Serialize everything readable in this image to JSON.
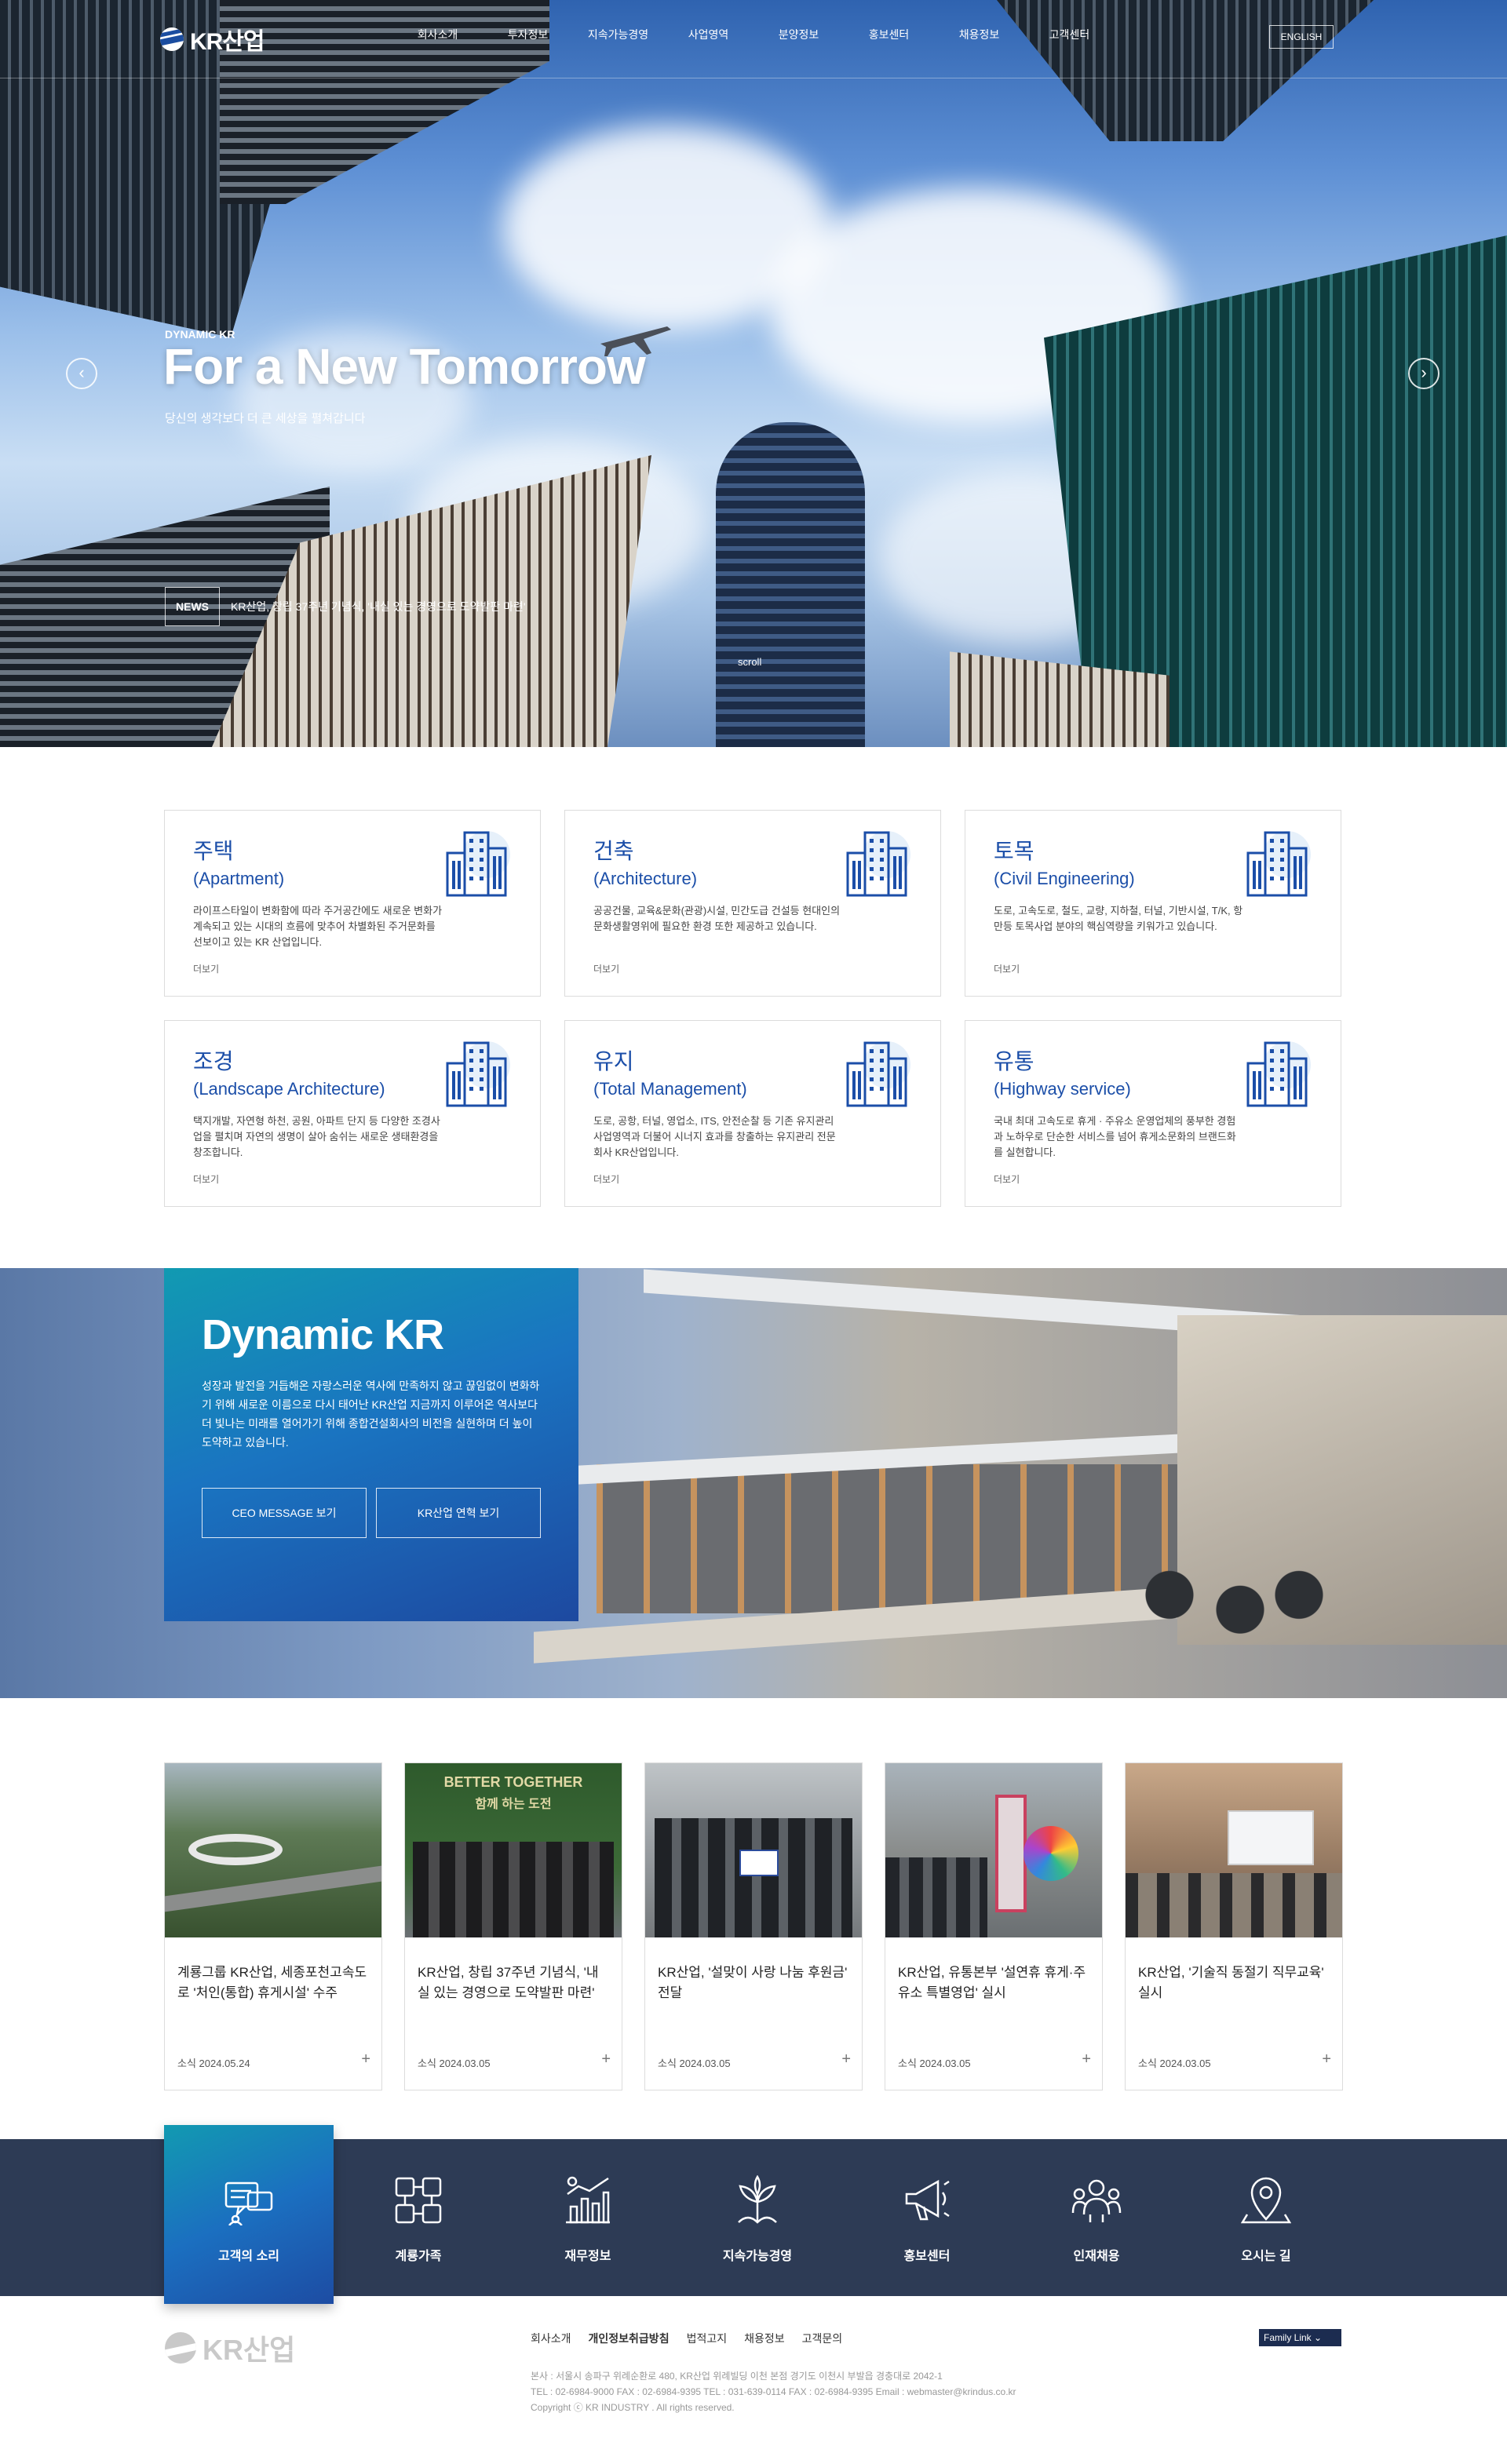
{
  "header": {
    "logo_text": "KR산업",
    "nav": [
      "회사소개",
      "투자정보",
      "지속가능경영",
      "사업영역",
      "분양정보",
      "홍보센터",
      "채용정보",
      "고객센터"
    ],
    "lang_button": "ENGLISH"
  },
  "hero": {
    "eyebrow": "DYNAMIC KR",
    "title": "For a New Tomorrow",
    "description": "당신의 생각보다 더 큰 세상을 펼쳐갑니다",
    "news_tag": "NEWS",
    "news_text": "KR산업, 창립 37주년 기념식, '내실 있는 경영으로 도약발판 마련'",
    "scroll_label": "scroll",
    "prev_icon": "chevron-left-icon",
    "next_icon": "chevron-right-icon"
  },
  "business": {
    "more_label": "더보기",
    "cards": [
      {
        "title": "주택",
        "subtitle": "(Apartment)",
        "desc": "라이프스타일이 변화함에 따라 주거공간에도 새로운 변화가 계속되고 있는 시대의 흐름에 맞추어 차별화된 주거문화를 선보이고 있는 KR 산업입니다."
      },
      {
        "title": "건축",
        "subtitle": "(Architecture)",
        "desc": "공공건물, 교육&문화(관광)시설, 민간도급 건설등 현대인의 문화생활영위에 필요한 환경 또한 제공하고 있습니다."
      },
      {
        "title": "토목",
        "subtitle": "(Civil Engineering)",
        "desc": "도로, 고속도로, 철도, 교량, 지하철, 터널, 기반시설, T/K, 항만등 토목사업 분야의 핵심역량을 키워가고 있습니다."
      },
      {
        "title": "조경",
        "subtitle": "(Landscape Architecture)",
        "desc": "택지개발, 자연형 하천, 공원, 아파트 단지 등 다양한 조경사업을 펼치며 자연의 생명이 살아 숨쉬는 새로운 생태환경을 창조합니다."
      },
      {
        "title": "유지",
        "subtitle": "(Total Management)",
        "desc": "도로, 공항, 터널, 영업소, ITS, 안전순찰 등 기존 유지관리 사업영역과 더불어 시너지 효과를 창출하는 유지관리 전문회사 KR산업입니다."
      },
      {
        "title": "유통",
        "subtitle": "(Highway service)",
        "desc": "국내 최대 고속도로 휴게 · 주유소 운영업체의 풍부한 경험과 노하우로 단순한 서비스를 넘어 휴게소문화의 브랜드화를 실현합니다."
      }
    ]
  },
  "dynamic": {
    "title": "Dynamic KR",
    "desc": "성장과 발전을 거듭해온 자랑스러운 역사에 만족하지 않고 끊임없이 변화하기 위해 새로운 이름으로 다시 태어난 KR산업 지금까지 이루어온 역사보다 더 빛나는 미래를 열어가기 위해 종합건설회사의 비전을 실현하며 더 높이 도약하고 있습니다.",
    "btn_ceo": "CEO MESSAGE 보기",
    "btn_history": "KR산업 연혁 보기"
  },
  "news": {
    "items": [
      {
        "title": "계룡그룹 KR산업, 세종포천고속도로 '처인(통합) 휴게시설' 수주",
        "date": "소식 2024.05.24"
      },
      {
        "title": "KR산업, 창립 37주년 기념식, '내실 있는 경영으로 도약발판 마련'",
        "date": "소식 2024.03.05"
      },
      {
        "title": "KR산업, '설맞이 사랑 나눔 후원금' 전달",
        "date": "소식 2024.03.05"
      },
      {
        "title": "KR산업, 유통본부 '설연휴 휴게·주유소 특별영업' 실시",
        "date": "소식 2024.03.05"
      },
      {
        "title": "KR산업, '기술직 동절기 직무교육' 실시",
        "date": "소식 2024.03.05"
      }
    ],
    "img2_banner": "BETTER TOGETHER",
    "img2_banner_sub": "함께 하는 도전"
  },
  "quick": {
    "items": [
      {
        "label": "고객의 소리",
        "icon": "customer-voice-icon"
      },
      {
        "label": "계룡가족",
        "icon": "family-companies-icon"
      },
      {
        "label": "재무정보",
        "icon": "financial-chart-icon"
      },
      {
        "label": "지속가능경영",
        "icon": "sustainability-icon"
      },
      {
        "label": "홍보센터",
        "icon": "megaphone-icon"
      },
      {
        "label": "인재채용",
        "icon": "recruit-people-icon"
      },
      {
        "label": "오시는 길",
        "icon": "location-pin-icon"
      }
    ]
  },
  "footer": {
    "logo_text": "KR산업",
    "links": [
      "회사소개",
      "개인정보취급방침",
      "법적고지",
      "채용정보",
      "고객문의"
    ],
    "family_link": "Family Link",
    "addr1": "본사 : 서울시 송파구 위례순환로 480, KR산업 위례빌딩 이천 본점 경기도 이천시 부발읍 경충대로 2042-1",
    "addr2": "TEL : 02-6984-9000 FAX : 02-6984-9395 TEL : 031-639-0114 FAX : 02-6984-9395 Email : webmaster@krindus.co.kr",
    "copyright": "Copyright ⓒ KR INDUSTRY . All rights reserved."
  },
  "colors": {
    "brand_blue": "#1b4ea8",
    "navy": "#2d3b55",
    "teal": "#129ab1"
  }
}
